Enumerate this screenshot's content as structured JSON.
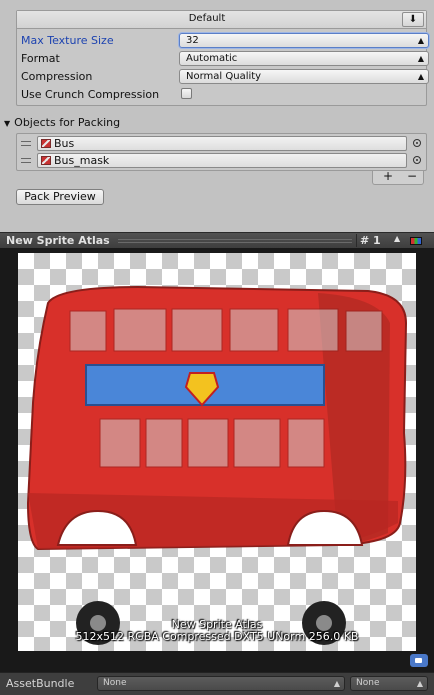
{
  "settings": {
    "tab_label": "Default",
    "download_icon": "download-icon",
    "max_texture_size": {
      "label": "Max Texture Size",
      "value": "32"
    },
    "format": {
      "label": "Format",
      "value": "Automatic"
    },
    "compression": {
      "label": "Compression",
      "value": "Normal Quality"
    },
    "crunch": {
      "label": "Use Crunch Compression",
      "checked": false
    }
  },
  "packing": {
    "section_title": "Objects for Packing",
    "items": [
      {
        "name": "Bus",
        "icon": "texture-icon"
      },
      {
        "name": "Bus_mask",
        "icon": "texture-icon"
      }
    ],
    "add_label": "+",
    "remove_label": "−",
    "pack_button": "Pack Preview"
  },
  "preview": {
    "title": "New Sprite Atlas",
    "page_label": "# 1",
    "info_line1": "New Sprite Atlas",
    "info_line2": "512x512 RGBA Compressed DXT5 UNorm   256.0 KB"
  },
  "asset_bundle": {
    "label": "AssetBundle",
    "name_value": "None",
    "variant_value": "None"
  },
  "colors": {
    "label_highlight": "#1d43b0",
    "bus_red": "#d8302a",
    "window_blue": "#4a86d8"
  }
}
